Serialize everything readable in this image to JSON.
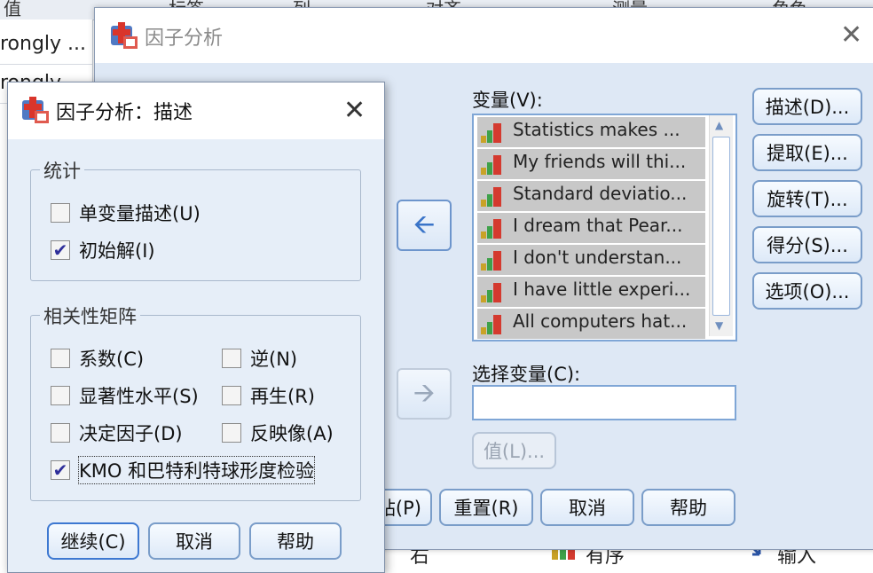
{
  "background": {
    "header_cols": [
      "值",
      "标签",
      "列",
      "对齐",
      "测量",
      "角色"
    ],
    "cells": [
      "rongly ...",
      "rongly"
    ],
    "bottom": [
      "右",
      "有序",
      "输入"
    ]
  },
  "main_dialog": {
    "title": "因子分析",
    "variables_label": "变量(V):",
    "variables": [
      "Statistics makes ...",
      "My friends will thi...",
      "Standard deviatio...",
      "I dream that Pear...",
      "I don't understan...",
      "I have little experi...",
      "All computers hat..."
    ],
    "selection_label": "选择变量(C):",
    "selection_value": "",
    "value_button": "值(L)...",
    "side_buttons": [
      "描述(D)...",
      "提取(E)...",
      "旋转(T)...",
      "得分(S)...",
      "选项(O)..."
    ],
    "bottom_buttons": [
      "粘贴(P)",
      "重置(R)",
      "取消",
      "帮助"
    ]
  },
  "sub_dialog": {
    "title": "因子分析：描述",
    "stats_group": "统计",
    "univariate": "单变量描述(U)",
    "initial": "初始解(I)",
    "corr_group": "相关性矩阵",
    "coefficients": "系数(C)",
    "inverse": "逆(N)",
    "significance": "显著性水平(S)",
    "reproduced": "再生(R)",
    "determinant": "决定因子(D)",
    "anti_image": "反映像(A)",
    "kmo": "KMO 和巴特利特球形度检验",
    "buttons": [
      "继续(C)",
      "取消",
      "帮助"
    ]
  },
  "colors": {
    "dialog_bg": "#dee8f5",
    "accent_border": "#7a9dc9",
    "check_color": "#2f2f9a"
  },
  "checks": {
    "univariate": false,
    "initial": true,
    "coefficients": false,
    "inverse": false,
    "significance": false,
    "reproduced": false,
    "determinant": false,
    "anti_image": false,
    "kmo": true
  }
}
